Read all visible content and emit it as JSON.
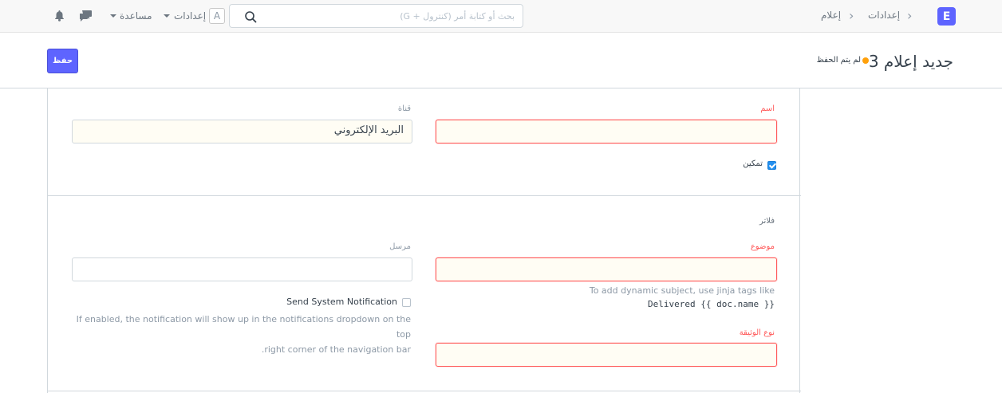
{
  "navbar": {
    "logo_letter": "E",
    "breadcrumbs": [
      "إعدادات",
      "إعلام"
    ],
    "search_placeholder": "بحث أو كتابة أمر (كنترول + G)",
    "avatar_letter": "A",
    "settings_label": "إعدادات",
    "help_label": "مساعدة"
  },
  "page": {
    "title": "جديد إعلام 3",
    "status": "لم يتم الحفظ",
    "status_color": "#ffa00a",
    "save_label": "حفظ"
  },
  "form": {
    "name_label": "اسم",
    "name_value": "",
    "channel_label": "قناة",
    "channel_value": "البريد الإلكتروني",
    "enabled_label": "تمكين",
    "enabled_checked": true,
    "filters_heading": "فلاتر",
    "subject_label": "موضوع",
    "subject_value": "",
    "subject_help": "To add dynamic subject, use jinja tags like",
    "subject_help_code": "Delivered {{ doc.name }}",
    "sender_label": "مرسل",
    "sender_value": "",
    "system_notification_label": "Send System Notification",
    "system_notification_checked": false,
    "system_notification_help_1": "If enabled, the notification will show up in the notifications dropdown on the top",
    "system_notification_help_2": "right corner of the navigation bar.",
    "doctype_label": "نوع الوثيقة",
    "doctype_value": ""
  },
  "colors": {
    "primary": "#5e64ff",
    "required": "#ff5858"
  }
}
